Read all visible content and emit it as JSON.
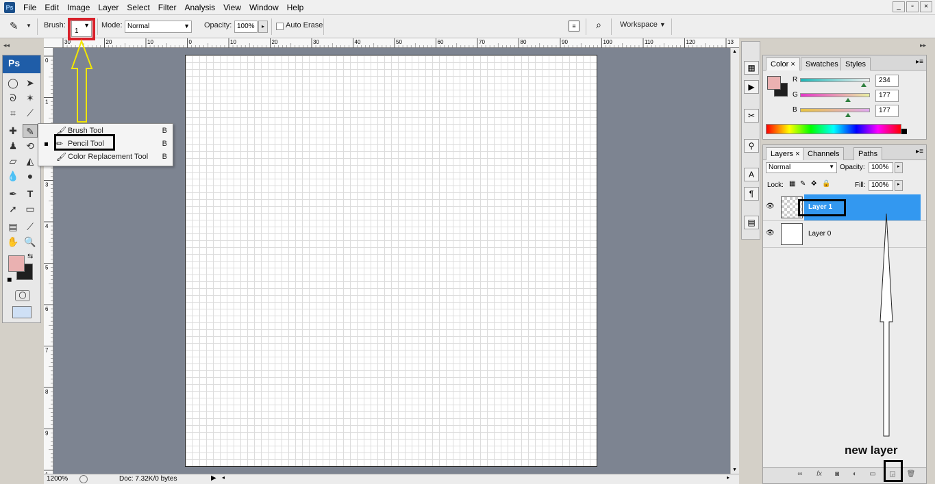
{
  "app": {
    "logo": "Ps"
  },
  "menu": [
    "File",
    "Edit",
    "Image",
    "Layer",
    "Select",
    "Filter",
    "Analysis",
    "View",
    "Window",
    "Help"
  ],
  "window_controls": [
    "_",
    "▫",
    "×"
  ],
  "options": {
    "brush_label": "Brush:",
    "brush_size": "1",
    "mode_label": "Mode:",
    "mode_value": "Normal",
    "opacity_label": "Opacity:",
    "opacity_value": "100%",
    "auto_erase_label": "Auto Erase",
    "workspace_label": "Workspace"
  },
  "toolbox": {
    "header": "Ps"
  },
  "flyout": [
    {
      "label": "Brush Tool",
      "key": "B",
      "icon": "brush-icon"
    },
    {
      "label": "Pencil Tool",
      "key": "B",
      "icon": "pencil-icon",
      "selected": true
    },
    {
      "label": "Color Replacement Tool",
      "key": "B",
      "icon": "color-replace-icon"
    }
  ],
  "ruler_top_labels": [
    "30",
    "20",
    "10",
    "0",
    "10",
    "20",
    "30",
    "40",
    "50",
    "60",
    "70",
    "80",
    "90",
    "100",
    "110",
    "120",
    "13"
  ],
  "ruler_left_labels": [
    "0",
    "1",
    "2",
    "3",
    "4",
    "5",
    "6",
    "7",
    "8",
    "9",
    "1"
  ],
  "status": {
    "zoom": "1200%",
    "doc": "Doc: 7.32K/0 bytes"
  },
  "color_panel": {
    "tabs": [
      "Color",
      "Swatches",
      "Styles"
    ],
    "foreground": "#eab1b1",
    "background": "#1f1f1f",
    "channels": [
      {
        "label": "R",
        "value": "234"
      },
      {
        "label": "G",
        "value": "177"
      },
      {
        "label": "B",
        "value": "177"
      }
    ]
  },
  "layers_panel": {
    "tabs": [
      "Layers",
      "Channels",
      "Paths"
    ],
    "blend_mode": "Normal",
    "opacity_label": "Opacity:",
    "opacity_value": "100%",
    "lock_label": "Lock:",
    "fill_label": "Fill:",
    "fill_value": "100%",
    "layers": [
      {
        "name": "Layer 1",
        "selected": true
      },
      {
        "name": "Layer 0",
        "selected": false
      }
    ]
  },
  "annotation": {
    "new_layer": "new layer"
  },
  "colors": {
    "accent": "#3398f0",
    "highlight_red": "#d8202a",
    "arrow_yellow": "#f2e600"
  }
}
